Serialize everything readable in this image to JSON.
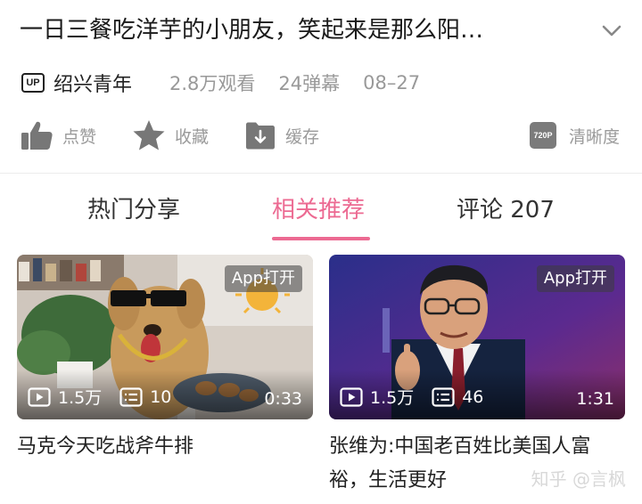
{
  "header": {
    "title": "一日三餐吃洋芋的小朋友，笑起来是那么阳…",
    "expand_icon": "chevron-down-icon"
  },
  "meta": {
    "up_badge": "UP",
    "author": "绍兴青年",
    "views": "2.8万观看",
    "danmaku": "24弹幕",
    "date": "08–27"
  },
  "actions": {
    "like": "点赞",
    "favorite": "收藏",
    "cache": "缓存",
    "quality_badge": "720P",
    "quality": "清晰度"
  },
  "tabs": [
    {
      "label": "热门分享",
      "active": false
    },
    {
      "label": "相关推荐",
      "active": true
    },
    {
      "label": "评论 207",
      "active": false
    }
  ],
  "videos": [
    {
      "app_label": "App打开",
      "plays": "1.5万",
      "danmaku": "10",
      "duration": "0:33",
      "title": "马克今天吃战斧牛排"
    },
    {
      "app_label": "App打开",
      "plays": "1.5万",
      "danmaku": "46",
      "duration": "1:31",
      "title": "张维为:中国老百姓比美国人富裕，生活更好"
    }
  ],
  "watermark": "知乎 @言枫",
  "colors": {
    "accent": "#ec6a92",
    "muted": "#999999"
  }
}
